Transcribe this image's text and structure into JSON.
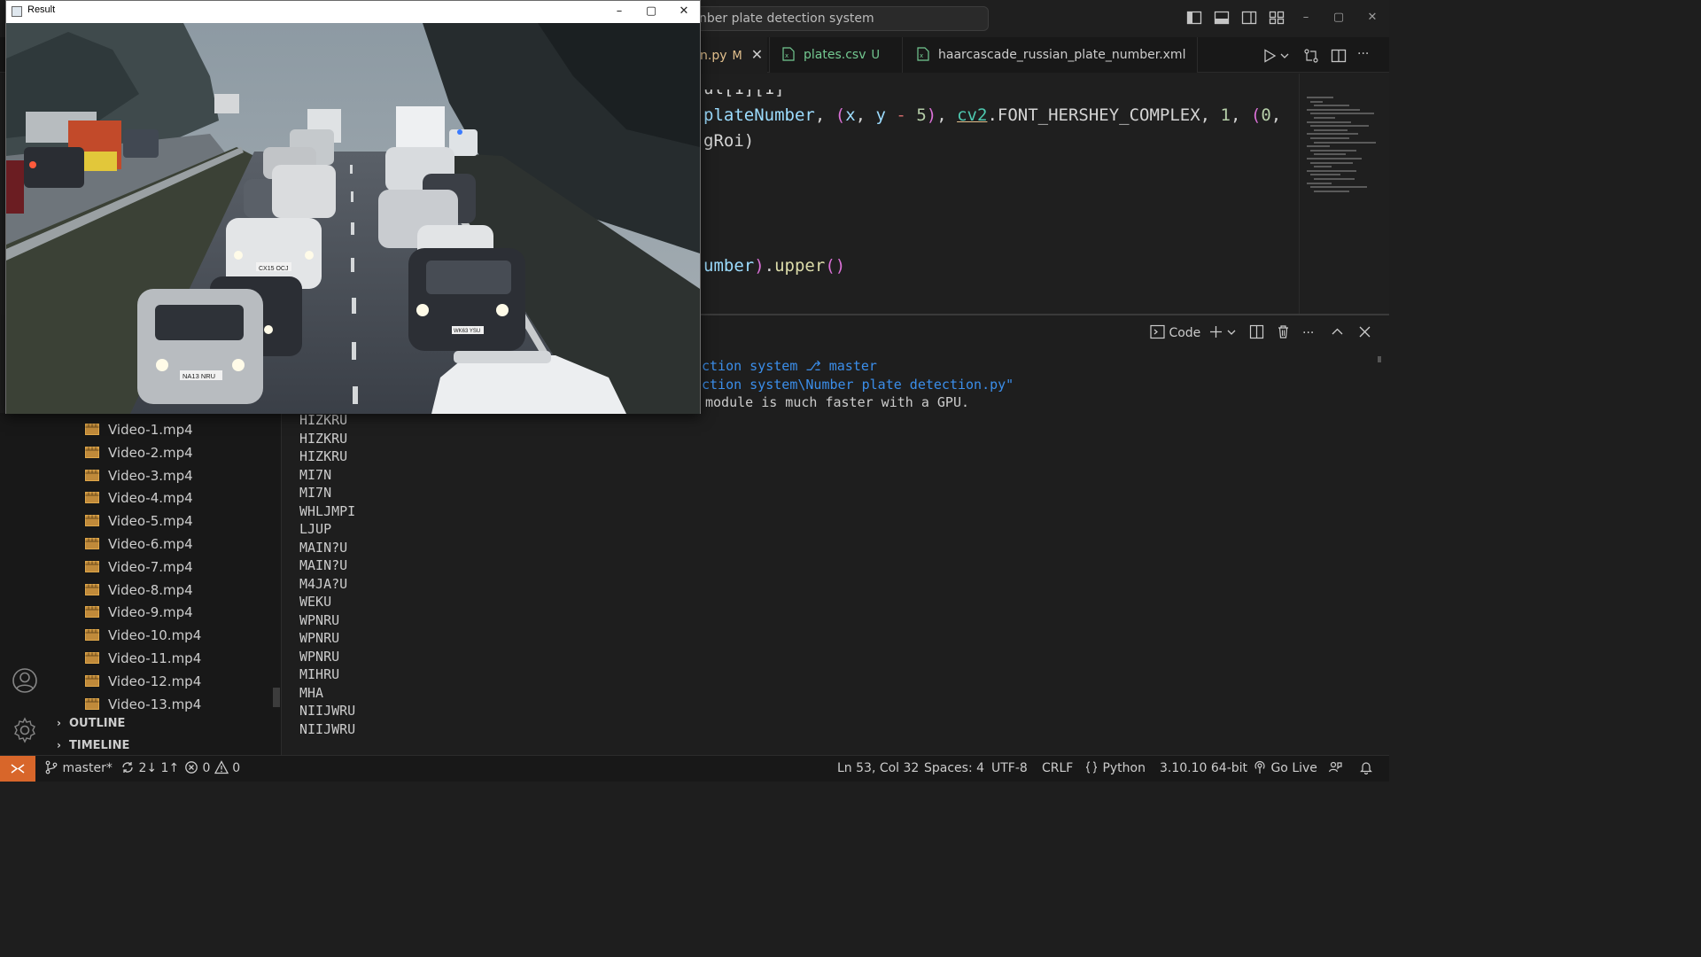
{
  "titlebar": {
    "command_center": "nber plate detection system",
    "window_controls": {
      "minimize": "–",
      "maximize": "▢",
      "close": "✕"
    }
  },
  "tabs": [
    {
      "name": "n.py",
      "status": "M",
      "close": "✕",
      "active": true
    },
    {
      "name": "plates.csv",
      "status": "U",
      "active": false
    },
    {
      "name": "haarcascade_russian_plate_number.xml",
      "status": "",
      "active": false
    }
  ],
  "tab_actions": {
    "more": "···"
  },
  "editor": {
    "line1_partial": "ul[1][1]",
    "line2": {
      "a": "plateNumber",
      "b": ", ",
      "c": "(x, y ",
      "d": "- ",
      "e": "5",
      "f": "), ",
      "g": "cv2",
      "h": ".FONT_HERSHEY_COMPLEX, ",
      "i": "1",
      "j": ", ",
      "k": "(0,"
    },
    "line3": "gRoi)",
    "line4": {
      "a": "umber",
      "b": ").",
      "c": "upper",
      "d": "()"
    }
  },
  "panel": {
    "toolbar": {
      "code_label": "Code",
      "more": "···"
    },
    "terminal_lines": [
      {
        "a": "ction system ",
        "b": "⎇",
        "c": " master"
      },
      {
        "text": "ction system\\Number plate detection.py\""
      },
      {
        "text": "module is much faster with a GPU."
      }
    ]
  },
  "sidebar": {
    "files": [
      "Video-1.mp4",
      "Video-2.mp4",
      "Video-3.mp4",
      "Video-4.mp4",
      "Video-5.mp4",
      "Video-6.mp4",
      "Video-7.mp4",
      "Video-8.mp4",
      "Video-9.mp4",
      "Video-10.mp4",
      "Video-11.mp4",
      "Video-12.mp4",
      "Video-13.mp4"
    ],
    "sections": {
      "outline": "OUTLINE",
      "timeline": "TIMELINE"
    }
  },
  "output_lines": [
    "HIZKRU",
    "HIZKRU",
    "HIZKRU",
    "MI7N",
    "MI7N",
    "WHLJMPI",
    "LJUP",
    "MAIN?U",
    "MAIN?U",
    "M4JA?U",
    "WEKU",
    "WPNRU",
    "WPNRU",
    "WPNRU",
    "MIHRU",
    "MHA",
    "NIIJWRU",
    "NIIJWRU"
  ],
  "statusbar": {
    "branch": "master*",
    "sync": "2↓ 1↑",
    "errors": "0",
    "warnings": "0",
    "position": "Ln 53, Col 32",
    "spaces": "Spaces: 4",
    "encoding": "UTF-8",
    "eol": "CRLF",
    "language": "Python",
    "interpreter": "3.10.10 64-bit",
    "go_live": "Go Live"
  },
  "result_window": {
    "title": "Result",
    "controls": {
      "minimize": "–",
      "maximize": "▢",
      "close": "✕"
    },
    "plates_visible": [
      "NA13 NRU",
      "CX15 OCJ",
      "WK63 YSU"
    ]
  },
  "colors": {
    "accent_remote": "#d8662a",
    "tab_modified": "#73c991",
    "editor_bg": "#1f1f1f"
  },
  "icons": {
    "activity": [
      "account-icon",
      "manage-gear-icon"
    ],
    "file": "video-file-icon"
  }
}
